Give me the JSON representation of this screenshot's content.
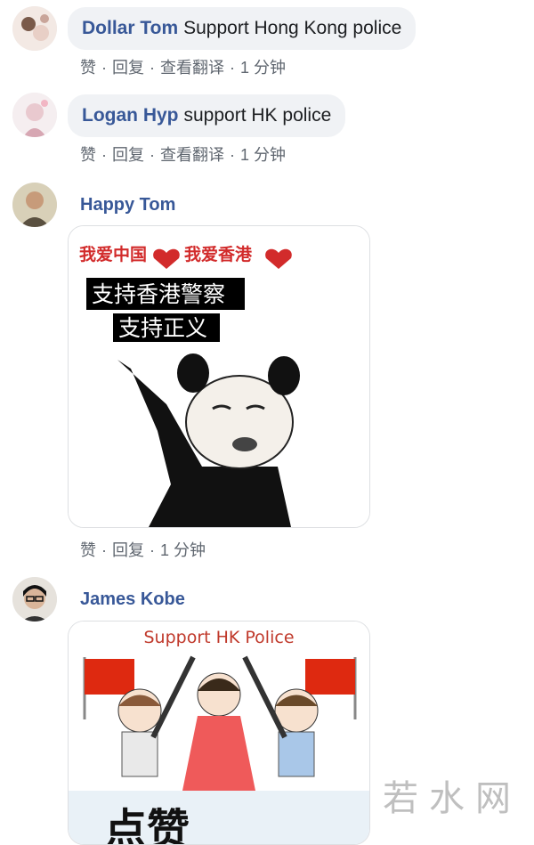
{
  "comments": [
    {
      "author": "Dollar Tom",
      "text": "Support Hong Kong police",
      "actions": {
        "like": "赞",
        "reply": "回复",
        "translate": "查看翻译",
        "time": "1 分钟"
      }
    },
    {
      "author": "Logan Hyp",
      "text": "support HK police",
      "actions": {
        "like": "赞",
        "reply": "回复",
        "translate": "查看翻译",
        "time": "1 分钟"
      }
    },
    {
      "author": "Happy Tom",
      "image": {
        "top_left": "我爱中国",
        "top_right": "我爱香港",
        "line1": "支持香港警察",
        "line2": "支持正义"
      },
      "actions": {
        "like": "赞",
        "reply": "回复",
        "time": "1 分钟"
      }
    },
    {
      "author": "James Kobe",
      "image": {
        "caption": "Support HK Police",
        "bottom_text": "点赞"
      }
    }
  ],
  "watermark": "若水网",
  "colors": {
    "author": "#385898",
    "bubble": "#f0f2f5",
    "meta": "#606770",
    "flag_red": "#de2910"
  }
}
